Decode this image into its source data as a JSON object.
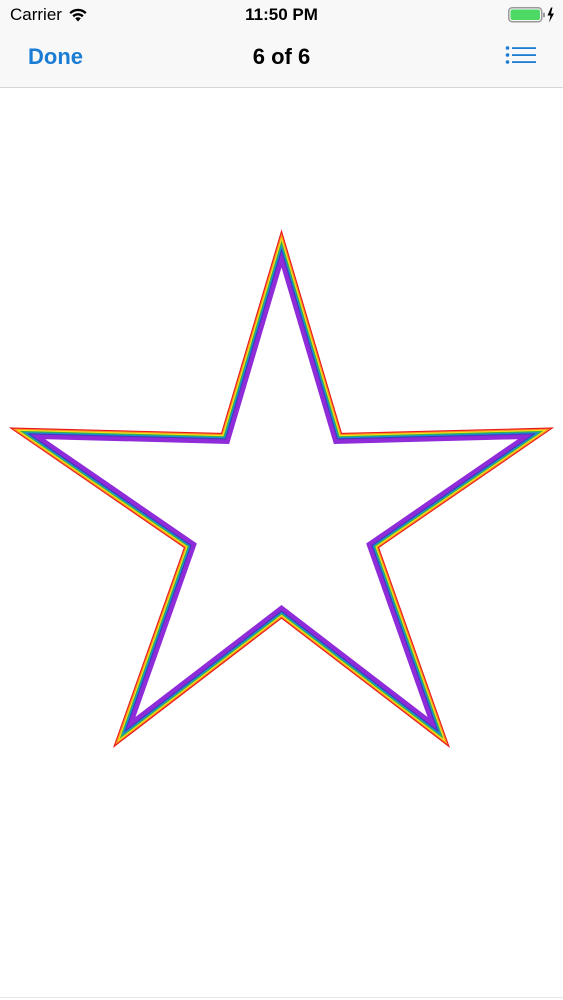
{
  "status_bar": {
    "carrier": "Carrier",
    "time": "11:50 PM",
    "wifi_icon": "wifi-icon",
    "battery_icon": "battery-charging-icon",
    "battery_color": "#4cd964"
  },
  "nav_bar": {
    "done_label": "Done",
    "title": "6 of 6",
    "list_icon": "list-icon",
    "accent_color": "#1a7cd3"
  },
  "content": {
    "image": "rainbow-star-outline",
    "stripe_colors": [
      "#e8161b",
      "#f7921e",
      "#f7e11c",
      "#35b34a",
      "#1c8fd6",
      "#3a3db8",
      "#8f2bd8"
    ]
  }
}
